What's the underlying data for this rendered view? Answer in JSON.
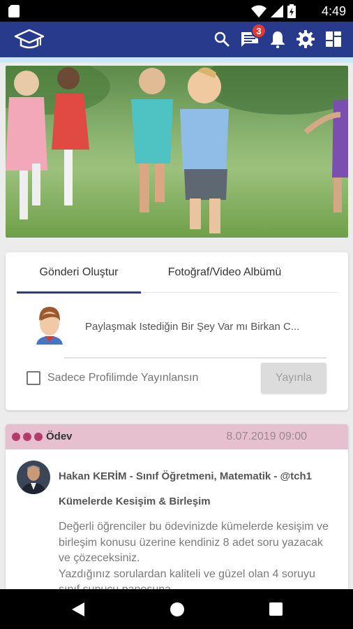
{
  "status_bar": {
    "time": "4:49"
  },
  "app_bar": {
    "icons": [
      "graduation-cap-icon",
      "search-icon",
      "messages-icon",
      "bell-icon",
      "gear-icon",
      "dashboard-icon"
    ],
    "messages_badge": "3",
    "color": "#283a8c"
  },
  "composer": {
    "tabs": [
      {
        "label": "Gönderi Oluştur",
        "active": true
      },
      {
        "label": "Fotoğraf/Video Albümü",
        "active": false
      }
    ],
    "placeholder": "Paylaşmak Istediğin Bir Şey Var mı Birkan C...",
    "profile_only_label": "Sadece Profilimde Yayınlansın",
    "profile_only_checked": false,
    "publish_label": "Yayınla"
  },
  "feed": {
    "items": [
      {
        "type": "Ödev",
        "date": "8.07.2019 09:00",
        "author": "Hakan KERİM - Sınıf Öğretmeni, Matematik - @tch1",
        "title": "Kümelerde Kesişim & Birleşim",
        "body": "Değerli öğrenciler bu ödevinizde kümelerde kesişim ve birleşim konusu üzerine kendiniz 8 adet soru yazacak ve çözeceksiniz.\nYazdığınız sorulardan kaliteli ve güzel olan 4 soruyu sınıf sunucu panosuna...",
        "header_color": "#e6c0cf"
      }
    ]
  }
}
